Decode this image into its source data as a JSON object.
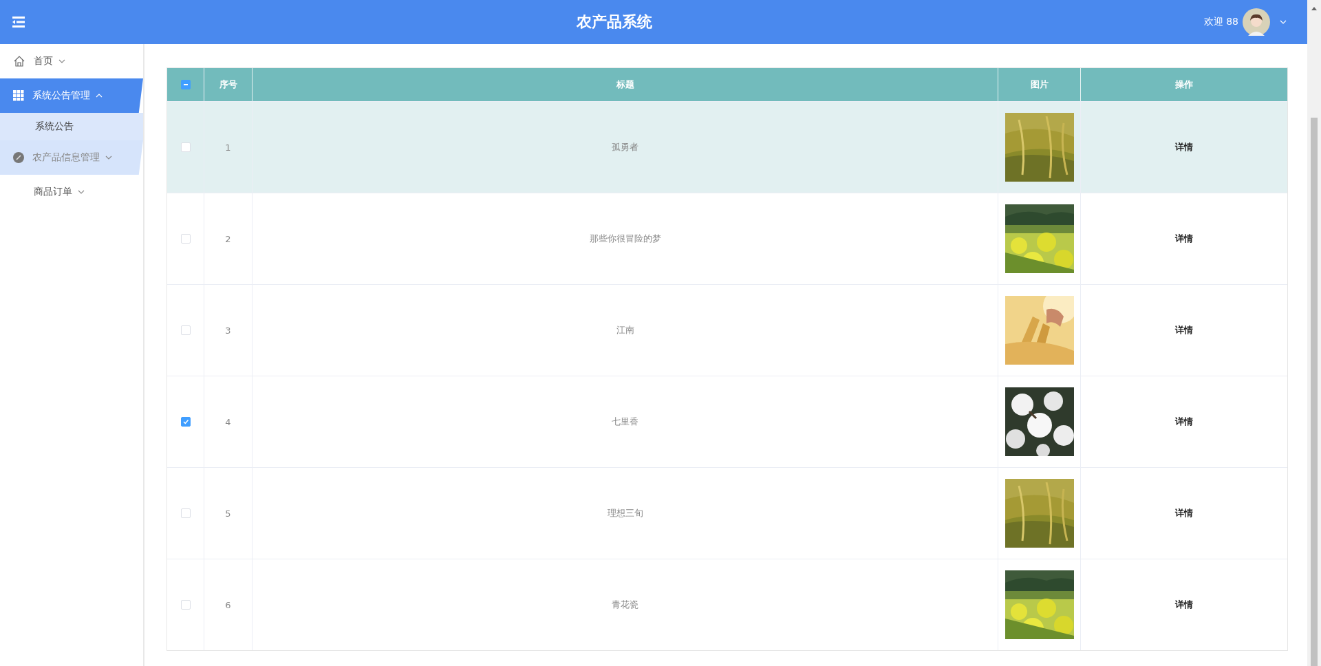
{
  "header": {
    "title": "农产品系统",
    "welcome": "欢迎 88"
  },
  "sidebar": {
    "items": [
      {
        "label": "首页",
        "expanded": false,
        "selected": false,
        "hovered": false
      },
      {
        "label": "系统公告管理",
        "expanded": true,
        "selected": true,
        "hovered": false,
        "children": [
          {
            "label": "系统公告",
            "selected": false
          }
        ]
      },
      {
        "label": "农产品信息管理",
        "expanded": false,
        "selected": false,
        "hovered": true
      },
      {
        "label": "商品订单",
        "expanded": false,
        "selected": false,
        "hovered": false
      }
    ]
  },
  "table": {
    "select_all": {
      "indeterminate": true
    },
    "columns": [
      "序号",
      "标题",
      "图片",
      "操作"
    ],
    "rows": [
      {
        "index": "1",
        "title": "孤勇者",
        "action": "详情",
        "checked": false,
        "highlighted": true
      },
      {
        "index": "2",
        "title": "那些你很冒险的梦",
        "action": "详情",
        "checked": false,
        "highlighted": false
      },
      {
        "index": "3",
        "title": "江南",
        "action": "详情",
        "checked": false,
        "highlighted": false
      },
      {
        "index": "4",
        "title": "七里香",
        "action": "详情",
        "checked": true,
        "highlighted": false
      },
      {
        "index": "5",
        "title": "理想三旬",
        "action": "详情",
        "checked": false,
        "highlighted": false
      },
      {
        "index": "6",
        "title": "青花瓷",
        "action": "详情",
        "checked": false,
        "highlighted": false
      }
    ]
  }
}
